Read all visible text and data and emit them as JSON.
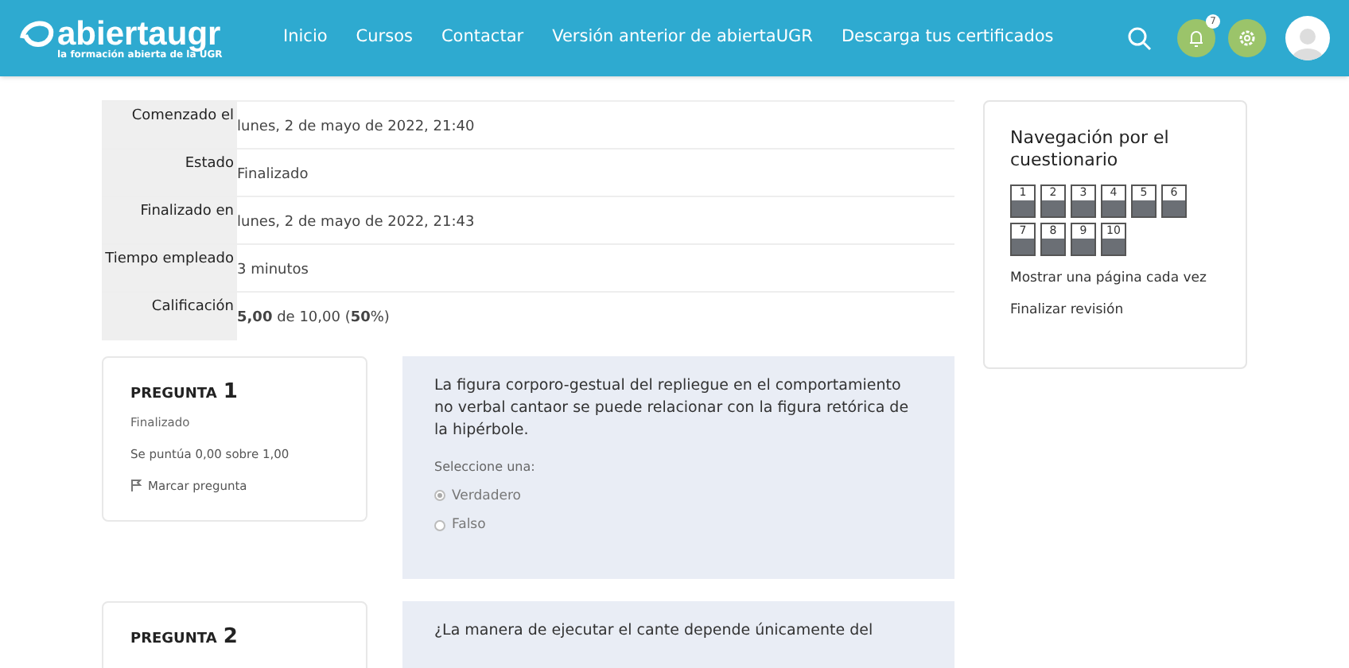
{
  "header": {
    "logo": {
      "name": "abiertaugr",
      "tagline": "la formación abierta de la UGR"
    },
    "nav": [
      "Inicio",
      "Cursos",
      "Contactar",
      "Versión anterior de abiertaUGR",
      "Descarga tus certificados"
    ],
    "notification_count": "7"
  },
  "summary": [
    {
      "label": "Comenzado el",
      "value": "lunes, 2 de mayo de 2022, 21:40"
    },
    {
      "label": "Estado",
      "value": "Finalizado"
    },
    {
      "label": "Finalizado en",
      "value": "lunes, 2 de mayo de 2022, 21:43"
    },
    {
      "label": "Tiempo empleado",
      "value": "3 minutos"
    },
    {
      "label": "Calificación",
      "value": "**5,00** de 10,00 (**50**%)"
    }
  ],
  "questions": [
    {
      "prefix": "PREGUNTA",
      "number": "1",
      "status": "Finalizado",
      "score": "Se puntúa 0,00 sobre 1,00",
      "flag": "Marcar pregunta",
      "text": "La figura corporo-gestual del repliegue en el comportamiento no verbal cantaor se puede relacionar con la figura retórica de la hipérbole.",
      "prompt": "Seleccione una:",
      "options": [
        {
          "label": "Verdadero",
          "selected": true
        },
        {
          "label": "Falso",
          "selected": false
        }
      ]
    },
    {
      "prefix": "PREGUNTA",
      "number": "2",
      "text": "¿La manera de ejecutar el cante depende únicamente del"
    }
  ],
  "quiz_nav": {
    "title": "Navegación por el cuestionario",
    "buttons": [
      {
        "label": "1",
        "answered": true
      },
      {
        "label": "2",
        "answered": true
      },
      {
        "label": "3",
        "answered": true
      },
      {
        "label": "4",
        "answered": true
      },
      {
        "label": "5",
        "answered": true
      },
      {
        "label": "6",
        "answered": true
      },
      {
        "label": "7",
        "answered": true
      },
      {
        "label": "8",
        "answered": true
      },
      {
        "label": "9",
        "answered": true
      },
      {
        "label": "10",
        "answered": true
      }
    ],
    "links": [
      "Mostrar una página cada vez",
      "Finalizar revisión"
    ]
  }
}
